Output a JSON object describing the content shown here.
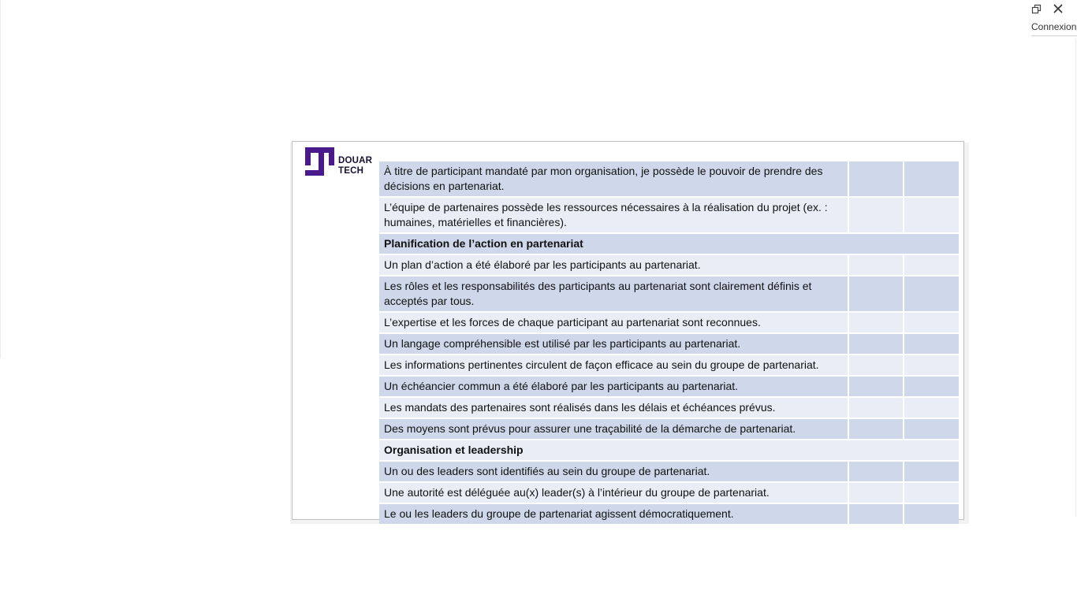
{
  "window": {
    "connexion_label": "Connexion",
    "restore_icon": "restore-window-icon",
    "close_icon": "close-icon"
  },
  "logo": {
    "text": "DOUAR\nTECH",
    "color": "#4a1a8c"
  },
  "colors": {
    "row_dark": "#cfd8ea",
    "row_light": "#e8edf6"
  },
  "survey": {
    "rows": [
      {
        "type": "item",
        "text": "À titre de participant mandaté par mon organisation, je possède le pouvoir de prendre des décisions en partenariat."
      },
      {
        "type": "item",
        "text": "L’équipe de partenaires possède les ressources nécessaires à la réalisation du projet (ex. : humaines, matérielles et financières)."
      },
      {
        "type": "section",
        "text": "Planification de l’action en partenariat"
      },
      {
        "type": "item",
        "text": "Un plan d’action a été élaboré par les participants au partenariat."
      },
      {
        "type": "item",
        "text": "Les rôles et les responsabilités des participants au partenariat sont clairement définis et acceptés par tous."
      },
      {
        "type": "item",
        "text": "L’expertise et les forces de chaque participant au partenariat sont reconnues."
      },
      {
        "type": "item",
        "text": "Un langage compréhensible est utilisé par les participants au partenariat."
      },
      {
        "type": "item",
        "text": "Les informations pertinentes circulent de façon efficace au sein du groupe de partenariat."
      },
      {
        "type": "item",
        "text": "Un échéancier commun a été élaboré par les participants au partenariat."
      },
      {
        "type": "item",
        "text": "Les mandats des partenaires sont réalisés dans les délais et échéances prévus."
      },
      {
        "type": "item",
        "text": "Des moyens sont prévus pour assurer une traçabilité de la démarche de partenariat."
      },
      {
        "type": "section",
        "text": "Organisation et leadership"
      },
      {
        "type": "item",
        "text": "Un ou des leaders sont identifiés au sein du groupe de partenariat."
      },
      {
        "type": "item",
        "text": "Une autorité est déléguée au(x) leader(s) à l’intérieur du groupe de partenariat."
      },
      {
        "type": "item",
        "text": "Le ou les leaders du groupe de partenariat agissent démocratiquement."
      }
    ]
  }
}
